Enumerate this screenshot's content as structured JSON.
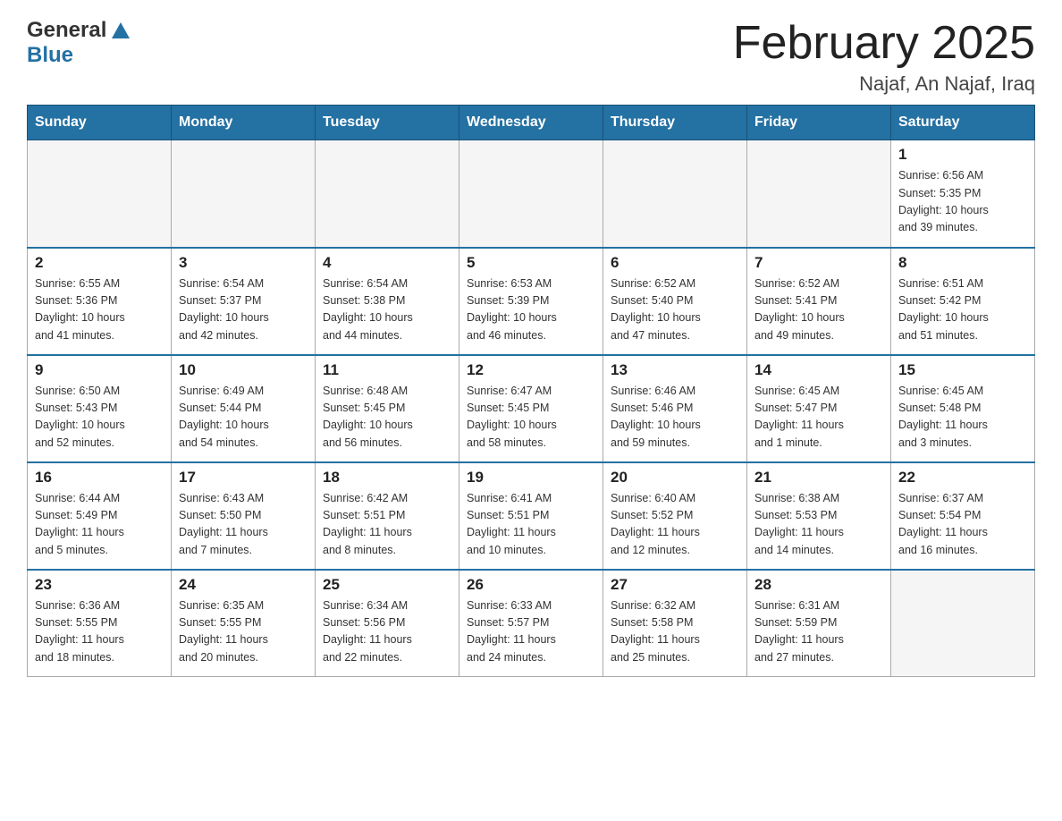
{
  "header": {
    "logo_general": "General",
    "logo_blue": "Blue",
    "title": "February 2025",
    "subtitle": "Najaf, An Najaf, Iraq"
  },
  "weekdays": [
    "Sunday",
    "Monday",
    "Tuesday",
    "Wednesday",
    "Thursday",
    "Friday",
    "Saturday"
  ],
  "weeks": [
    [
      {
        "day": "",
        "info": ""
      },
      {
        "day": "",
        "info": ""
      },
      {
        "day": "",
        "info": ""
      },
      {
        "day": "",
        "info": ""
      },
      {
        "day": "",
        "info": ""
      },
      {
        "day": "",
        "info": ""
      },
      {
        "day": "1",
        "info": "Sunrise: 6:56 AM\nSunset: 5:35 PM\nDaylight: 10 hours\nand 39 minutes."
      }
    ],
    [
      {
        "day": "2",
        "info": "Sunrise: 6:55 AM\nSunset: 5:36 PM\nDaylight: 10 hours\nand 41 minutes."
      },
      {
        "day": "3",
        "info": "Sunrise: 6:54 AM\nSunset: 5:37 PM\nDaylight: 10 hours\nand 42 minutes."
      },
      {
        "day": "4",
        "info": "Sunrise: 6:54 AM\nSunset: 5:38 PM\nDaylight: 10 hours\nand 44 minutes."
      },
      {
        "day": "5",
        "info": "Sunrise: 6:53 AM\nSunset: 5:39 PM\nDaylight: 10 hours\nand 46 minutes."
      },
      {
        "day": "6",
        "info": "Sunrise: 6:52 AM\nSunset: 5:40 PM\nDaylight: 10 hours\nand 47 minutes."
      },
      {
        "day": "7",
        "info": "Sunrise: 6:52 AM\nSunset: 5:41 PM\nDaylight: 10 hours\nand 49 minutes."
      },
      {
        "day": "8",
        "info": "Sunrise: 6:51 AM\nSunset: 5:42 PM\nDaylight: 10 hours\nand 51 minutes."
      }
    ],
    [
      {
        "day": "9",
        "info": "Sunrise: 6:50 AM\nSunset: 5:43 PM\nDaylight: 10 hours\nand 52 minutes."
      },
      {
        "day": "10",
        "info": "Sunrise: 6:49 AM\nSunset: 5:44 PM\nDaylight: 10 hours\nand 54 minutes."
      },
      {
        "day": "11",
        "info": "Sunrise: 6:48 AM\nSunset: 5:45 PM\nDaylight: 10 hours\nand 56 minutes."
      },
      {
        "day": "12",
        "info": "Sunrise: 6:47 AM\nSunset: 5:45 PM\nDaylight: 10 hours\nand 58 minutes."
      },
      {
        "day": "13",
        "info": "Sunrise: 6:46 AM\nSunset: 5:46 PM\nDaylight: 10 hours\nand 59 minutes."
      },
      {
        "day": "14",
        "info": "Sunrise: 6:45 AM\nSunset: 5:47 PM\nDaylight: 11 hours\nand 1 minute."
      },
      {
        "day": "15",
        "info": "Sunrise: 6:45 AM\nSunset: 5:48 PM\nDaylight: 11 hours\nand 3 minutes."
      }
    ],
    [
      {
        "day": "16",
        "info": "Sunrise: 6:44 AM\nSunset: 5:49 PM\nDaylight: 11 hours\nand 5 minutes."
      },
      {
        "day": "17",
        "info": "Sunrise: 6:43 AM\nSunset: 5:50 PM\nDaylight: 11 hours\nand 7 minutes."
      },
      {
        "day": "18",
        "info": "Sunrise: 6:42 AM\nSunset: 5:51 PM\nDaylight: 11 hours\nand 8 minutes."
      },
      {
        "day": "19",
        "info": "Sunrise: 6:41 AM\nSunset: 5:51 PM\nDaylight: 11 hours\nand 10 minutes."
      },
      {
        "day": "20",
        "info": "Sunrise: 6:40 AM\nSunset: 5:52 PM\nDaylight: 11 hours\nand 12 minutes."
      },
      {
        "day": "21",
        "info": "Sunrise: 6:38 AM\nSunset: 5:53 PM\nDaylight: 11 hours\nand 14 minutes."
      },
      {
        "day": "22",
        "info": "Sunrise: 6:37 AM\nSunset: 5:54 PM\nDaylight: 11 hours\nand 16 minutes."
      }
    ],
    [
      {
        "day": "23",
        "info": "Sunrise: 6:36 AM\nSunset: 5:55 PM\nDaylight: 11 hours\nand 18 minutes."
      },
      {
        "day": "24",
        "info": "Sunrise: 6:35 AM\nSunset: 5:55 PM\nDaylight: 11 hours\nand 20 minutes."
      },
      {
        "day": "25",
        "info": "Sunrise: 6:34 AM\nSunset: 5:56 PM\nDaylight: 11 hours\nand 22 minutes."
      },
      {
        "day": "26",
        "info": "Sunrise: 6:33 AM\nSunset: 5:57 PM\nDaylight: 11 hours\nand 24 minutes."
      },
      {
        "day": "27",
        "info": "Sunrise: 6:32 AM\nSunset: 5:58 PM\nDaylight: 11 hours\nand 25 minutes."
      },
      {
        "day": "28",
        "info": "Sunrise: 6:31 AM\nSunset: 5:59 PM\nDaylight: 11 hours\nand 27 minutes."
      },
      {
        "day": "",
        "info": ""
      }
    ]
  ]
}
